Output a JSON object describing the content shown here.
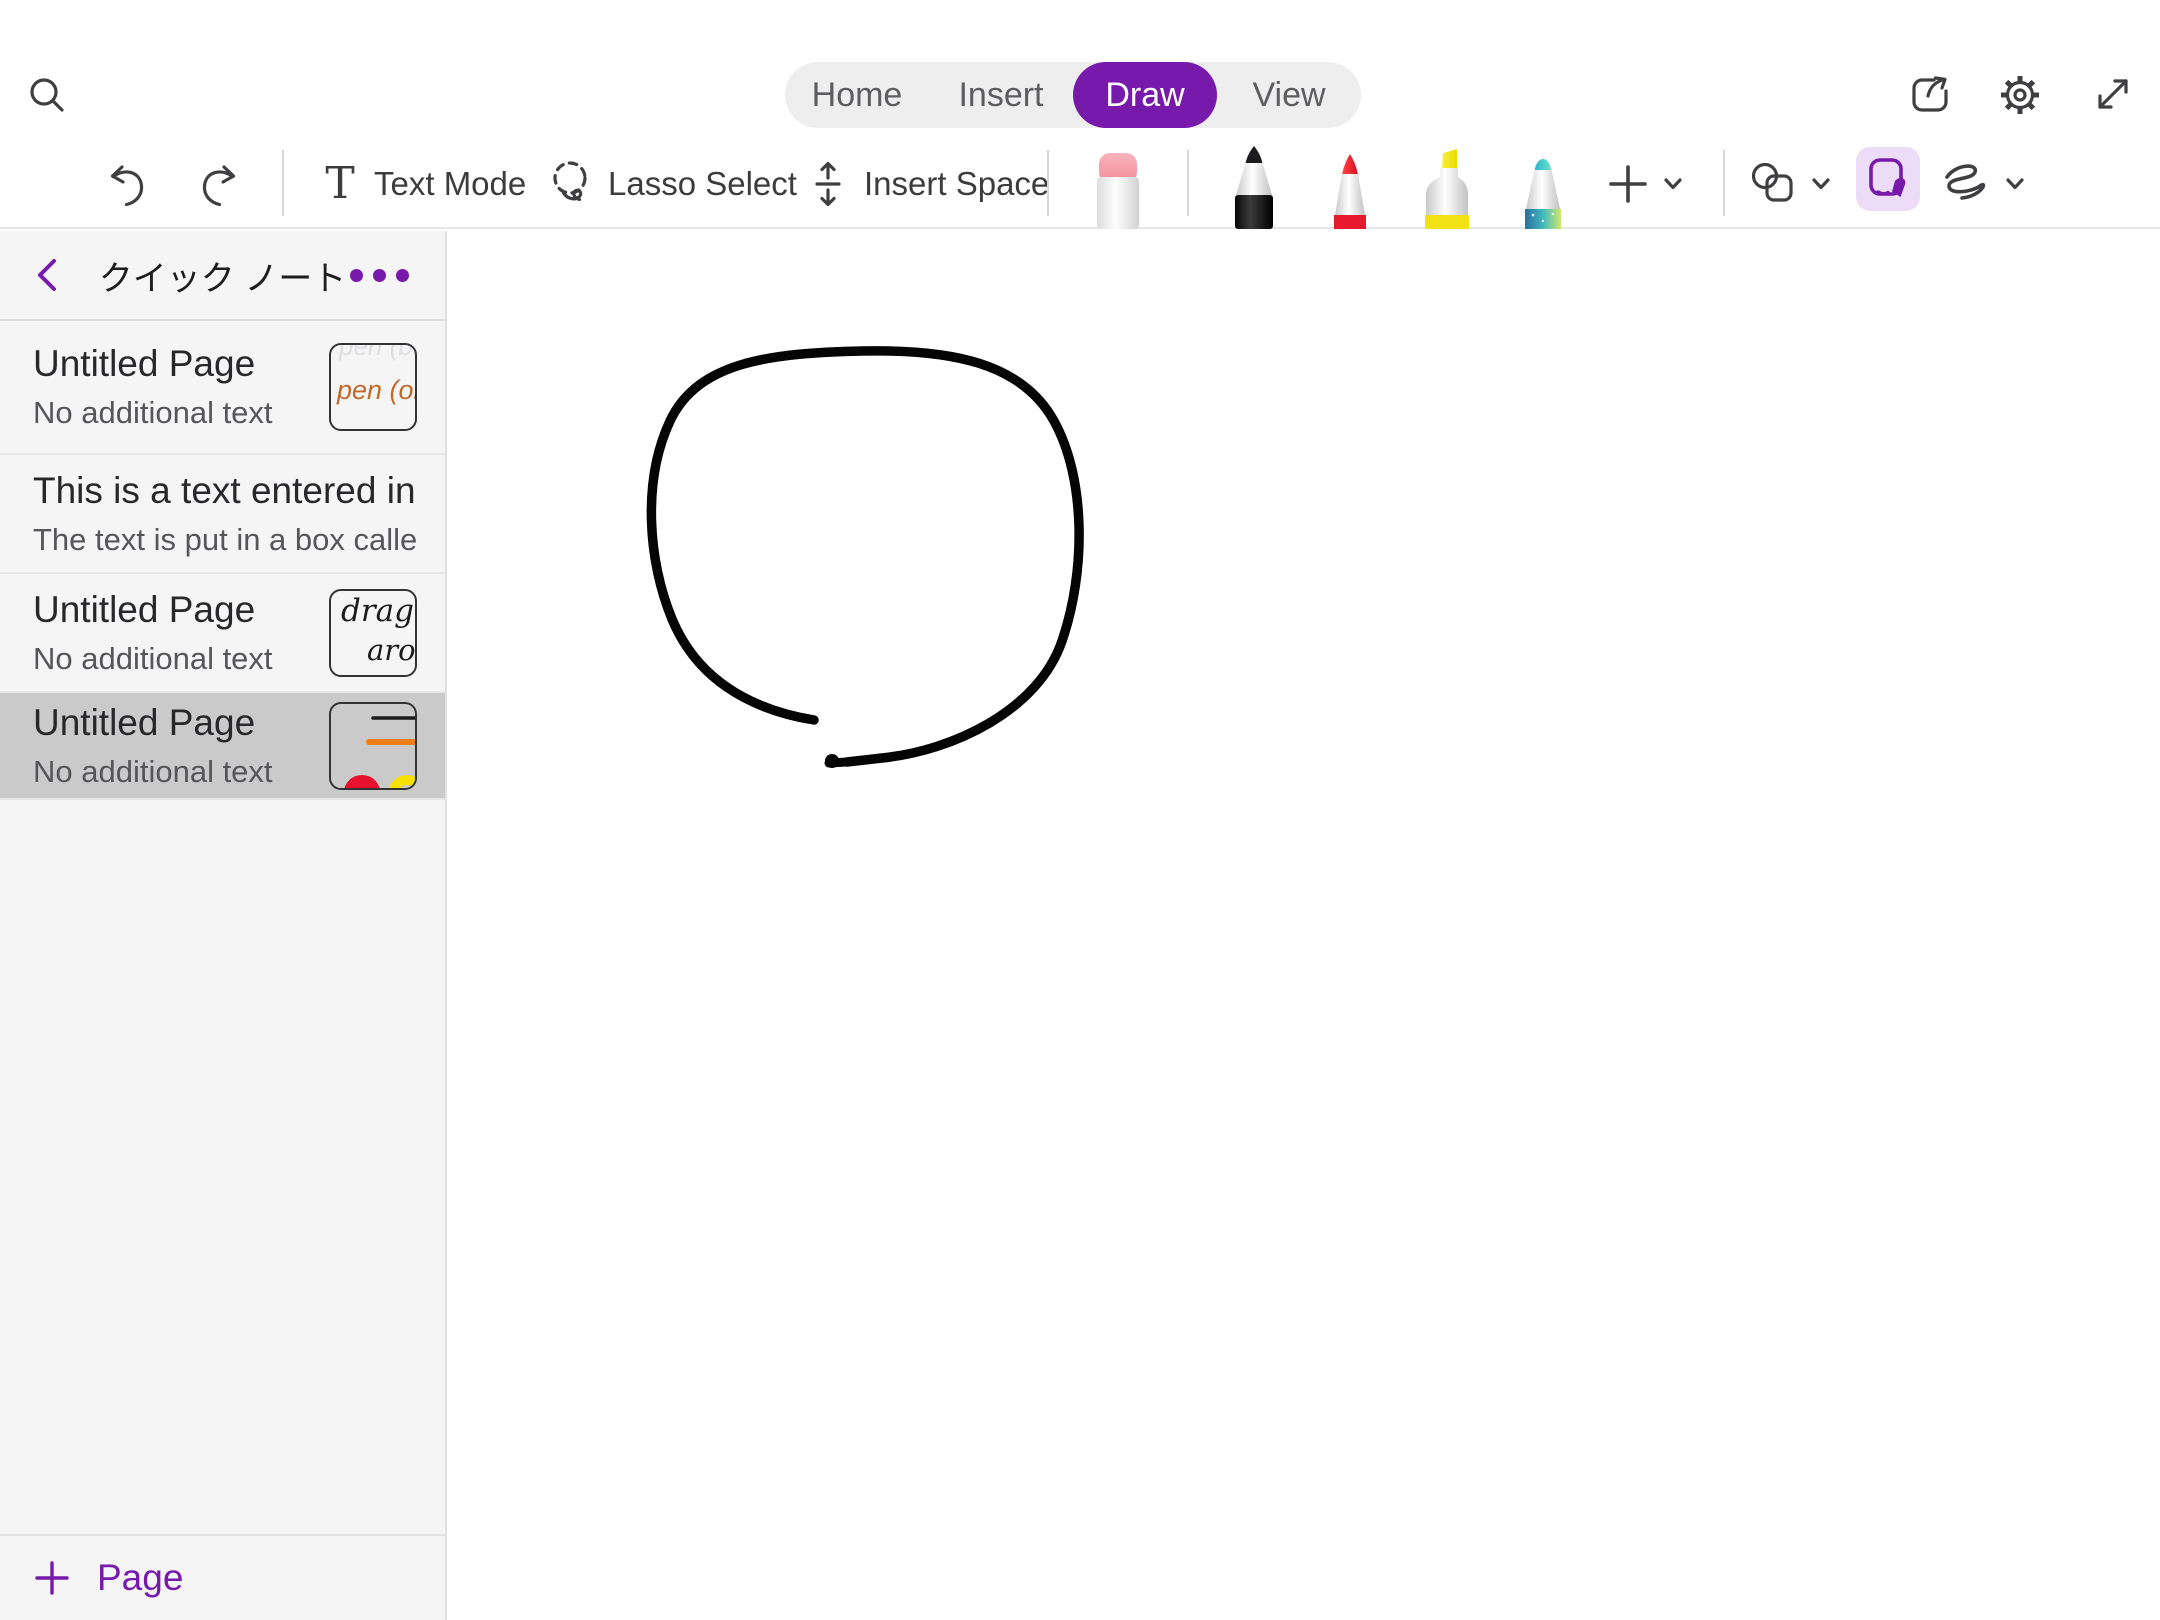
{
  "header": {
    "tabs": [
      {
        "label": "Home"
      },
      {
        "label": "Insert"
      },
      {
        "label": "Draw"
      },
      {
        "label": "View"
      }
    ],
    "active_tab": "Draw"
  },
  "toolbar": {
    "text_mode_label": "Text Mode",
    "lasso_label": "Lasso Select",
    "insert_space_label": "Insert Space",
    "tools": [
      {
        "name": "eraser",
        "color": "#f6a0ac"
      },
      {
        "name": "pen-black",
        "color": "#1c1c1e"
      },
      {
        "name": "pen-red",
        "color": "#e8192d"
      },
      {
        "name": "highlighter-yellow",
        "color": "#f2e215"
      },
      {
        "name": "pen-teal",
        "color": "#41c8c0"
      }
    ],
    "active_tool": "ink-note"
  },
  "sidebar": {
    "notebook_title": "クイック ノート",
    "pages": [
      {
        "title": "Untitled Page",
        "subtitle": "No additional text",
        "selected": false,
        "thumbnail_lines": [
          "pen (bl",
          "pen (ora"
        ]
      },
      {
        "title": "This is a text entered in...",
        "subtitle": "The text is put in a box called...",
        "selected": false
      },
      {
        "title": "Untitled Page",
        "subtitle": "No additional text",
        "selected": false,
        "thumbnail_lines": [
          "drag",
          "arou"
        ]
      },
      {
        "title": "Untitled Page",
        "subtitle": "No additional text",
        "selected": true
      }
    ],
    "add_page_label": "Page"
  },
  "canvas": {
    "content": "hand-drawn black circle, open at bottom"
  },
  "colors": {
    "accent_purple": "#7719aa",
    "active_tool_bg": "#ecdcf7",
    "selected_row": "#cbcacb",
    "tab_pill_bg": "#efeeef"
  }
}
